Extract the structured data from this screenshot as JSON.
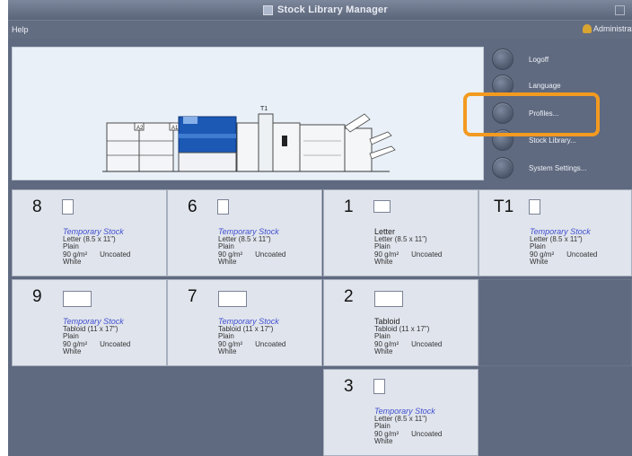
{
  "window": {
    "title": "Stock Library Manager"
  },
  "menu": {
    "help": "Help",
    "user": "Administrat"
  },
  "sidebar": {
    "buttons": [
      {
        "label": "Logoff"
      },
      {
        "label": "Language"
      },
      {
        "label": "Profiles..."
      },
      {
        "label": "Stock Library..."
      },
      {
        "label": "System Settings..."
      }
    ]
  },
  "printer": {
    "tray_label_t1": "T1",
    "tray_a1": "A1",
    "tray_a2": "A2"
  },
  "trays": [
    {
      "id": "8",
      "stock_name": "Temporary Stock",
      "size": "Letter (8.5 x 11\")",
      "type": "Plain",
      "weight": "90 g/m²",
      "coating": "Uncoated",
      "color": "White",
      "temporary": true,
      "orientation": "portrait"
    },
    {
      "id": "6",
      "stock_name": "Temporary Stock",
      "size": "Letter (8.5 x 11\")",
      "type": "Plain",
      "weight": "90 g/m²",
      "coating": "Uncoated",
      "color": "White",
      "temporary": true,
      "orientation": "portrait"
    },
    {
      "id": "1",
      "stock_name": "Letter",
      "size": "Letter (8.5 x 11\")",
      "type": "Plain",
      "weight": "90 g/m²",
      "coating": "Uncoated",
      "color": "White",
      "temporary": false,
      "orientation": "landscape-small"
    },
    {
      "id": "T1",
      "stock_name": "Temporary Stock",
      "size": "Letter (8.5 x 11\")",
      "type": "Plain",
      "weight": "90 g/m²",
      "coating": "Uncoated",
      "color": "White",
      "temporary": true,
      "orientation": "portrait"
    },
    {
      "id": "9",
      "stock_name": "Temporary Stock",
      "size": "Tabloid (11 x 17\")",
      "type": "Plain",
      "weight": "90 g/m²",
      "coating": "Uncoated",
      "color": "White",
      "temporary": true,
      "orientation": "landscape"
    },
    {
      "id": "7",
      "stock_name": "Temporary Stock",
      "size": "Tabloid (11 x 17\")",
      "type": "Plain",
      "weight": "90 g/m²",
      "coating": "Uncoated",
      "color": "White",
      "temporary": true,
      "orientation": "landscape"
    },
    {
      "id": "2",
      "stock_name": "Tabloid",
      "size": "Tabloid (11 x 17\")",
      "type": "Plain",
      "weight": "90 g/m²",
      "coating": "Uncoated",
      "color": "White",
      "temporary": false,
      "orientation": "landscape"
    },
    {
      "id": "3",
      "stock_name": "Temporary Stock",
      "size": "Letter (8.5 x 11\")",
      "type": "Plain",
      "weight": "90 g/m²",
      "coating": "Uncoated",
      "color": "White",
      "temporary": true,
      "orientation": "portrait"
    }
  ],
  "colors": {
    "background": "#5f6a80",
    "tile": "#e0e4ec",
    "temporary_text": "#3f4fd0",
    "highlight": "#f39a21"
  }
}
